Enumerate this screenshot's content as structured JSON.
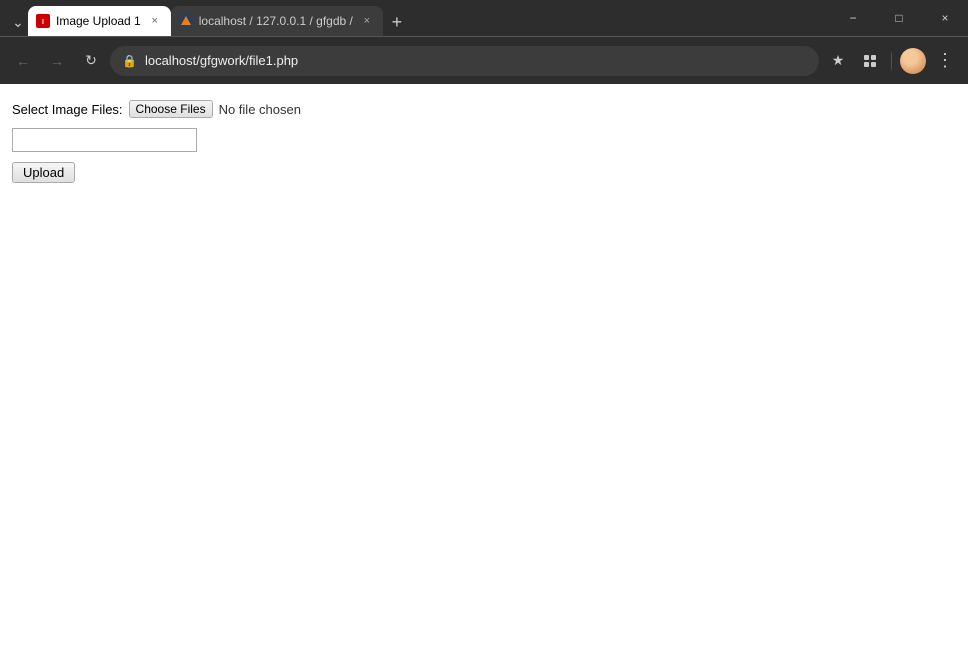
{
  "browser": {
    "tabs": [
      {
        "id": "tab1",
        "title": "Image Upload 1",
        "favicon": "image-upload-favicon",
        "url": "localhost/gfgwork/file1.php",
        "active": true,
        "close_label": "×"
      },
      {
        "id": "tab2",
        "title": "localhost / 127.0.0.1 / gfgdb /",
        "favicon": "gfgdb-favicon",
        "url": "localhost / 127.0.0.1 / gfgdb /",
        "active": false,
        "close_label": "×"
      }
    ],
    "new_tab_label": "+",
    "window_controls": {
      "minimize": "−",
      "maximize": "□",
      "close": "×"
    },
    "nav": {
      "back": "←",
      "forward": "→",
      "reload": "↻"
    },
    "url": "localhost/gfgwork/file1.php",
    "address_bar_icons": {
      "lock": "🔒",
      "bookmark": "☆",
      "extension": "🧩",
      "account": "👤",
      "menu": "⋮"
    }
  },
  "page": {
    "form": {
      "label": "Select Image Files:",
      "file_button_label": "Choose Files",
      "no_file_text": "No file chosen",
      "text_input_value": "",
      "text_input_placeholder": "",
      "upload_button_label": "Upload"
    }
  }
}
